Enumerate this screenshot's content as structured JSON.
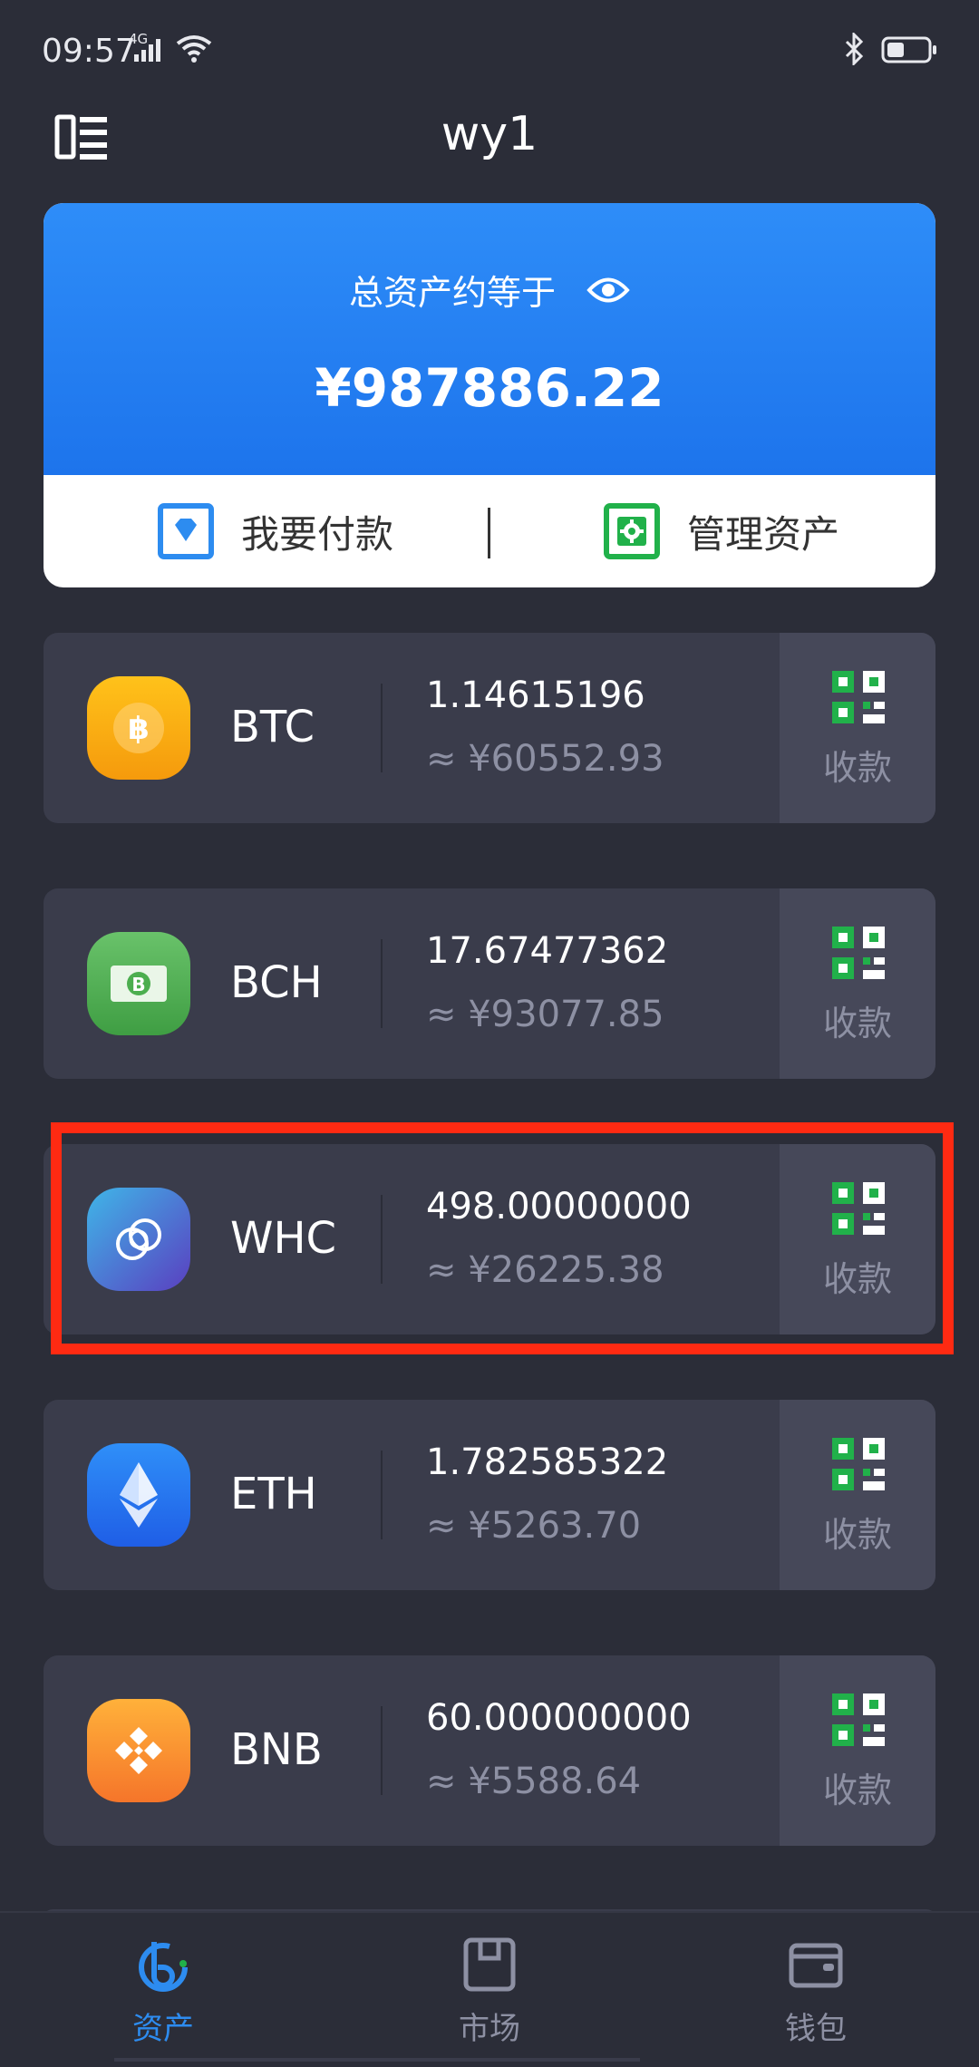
{
  "status_bar": {
    "time": "09:57",
    "network": "4G"
  },
  "header": {
    "title": "wy1"
  },
  "summary": {
    "label": "总资产约等于",
    "total": "¥987886.22",
    "actions": [
      {
        "label": "我要付款",
        "icon": "diamond-icon",
        "color": "#2d8cf0"
      },
      {
        "label": "管理资产",
        "icon": "gear-icon",
        "color": "#21b14a"
      }
    ]
  },
  "assets": [
    {
      "symbol": "BTC",
      "amount": "1.14615196",
      "fiat": "≈ ¥60552.93",
      "receive": "收款",
      "icon": "bitcoin-icon",
      "color": "#f5a623"
    },
    {
      "symbol": "BCH",
      "amount": "17.67477362",
      "fiat": "≈ ¥93077.85",
      "receive": "收款",
      "icon": "bitcoin-cash-icon",
      "color": "#4cae4f"
    },
    {
      "symbol": "WHC",
      "amount": "498.00000000",
      "fiat": "≈ ¥26225.38",
      "receive": "收款",
      "icon": "wormhole-icon",
      "color": "#3b5fd9"
    },
    {
      "symbol": "ETH",
      "amount": "1.782585322",
      "fiat": "≈ ¥5263.70",
      "receive": "收款",
      "icon": "ethereum-icon",
      "color": "#2a7cf6"
    },
    {
      "symbol": "BNB",
      "amount": "60.000000000",
      "fiat": "≈ ¥5588.64",
      "receive": "收款",
      "icon": "binance-icon",
      "color": "#f58a26"
    }
  ],
  "nav": {
    "items": [
      {
        "label": "资产",
        "icon": "assets-icon",
        "active": true
      },
      {
        "label": "市场",
        "icon": "market-icon",
        "active": false
      },
      {
        "label": "钱包",
        "icon": "wallet-icon",
        "active": false
      }
    ]
  },
  "colors": {
    "accent": "#2d8cf0",
    "highlight": "#ff2a12",
    "background": "#2b2d38"
  }
}
